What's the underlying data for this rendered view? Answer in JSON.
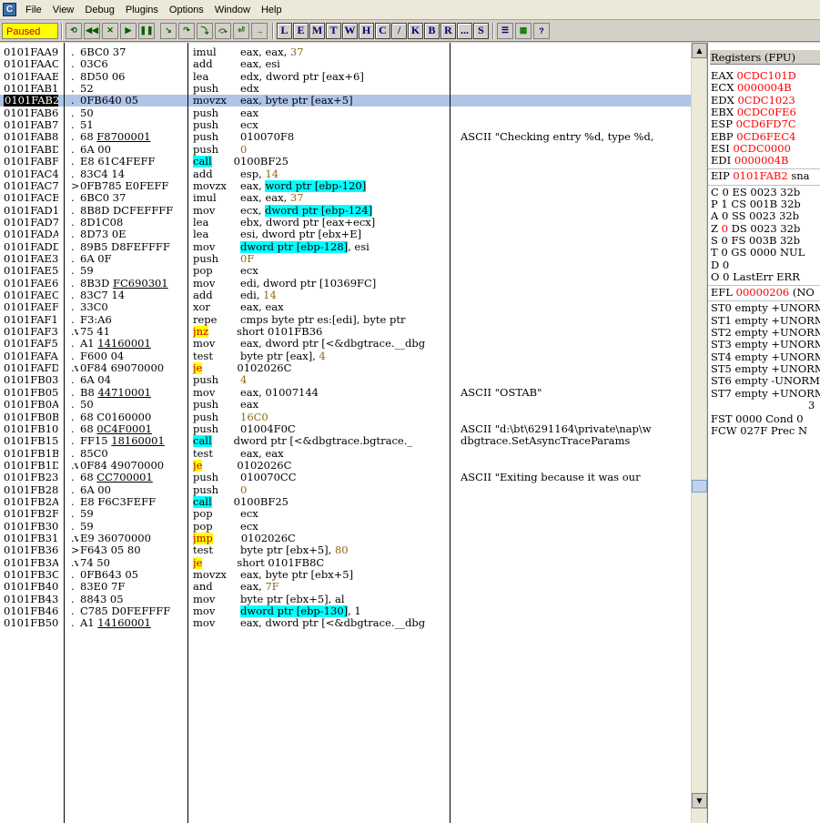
{
  "menu": [
    "File",
    "View",
    "Debug",
    "Plugins",
    "Options",
    "Window",
    "Help"
  ],
  "toolbar": {
    "status": "Paused",
    "buttons": [
      "restart-icon",
      "rewind-icon",
      "close-icon",
      "play-icon",
      "pause-icon",
      "step-into-icon",
      "step-over-icon",
      "trace-into-icon",
      "trace-over-icon",
      "execute-till-return-icon",
      "goto-icon"
    ],
    "letters": [
      "L",
      "E",
      "M",
      "T",
      "W",
      "H",
      "C",
      "/",
      "K",
      "B",
      "R",
      "...",
      "S"
    ]
  },
  "disasm": [
    {
      "addr": "0101FAA9",
      "sym": ".",
      "hex": "6BC0 37",
      "mn": "imul",
      "ops": "eax, eax, 37",
      "cmt": ""
    },
    {
      "addr": "0101FAAC",
      "sym": ".",
      "hex": "03C6",
      "mn": "add",
      "ops": "eax, esi",
      "cmt": ""
    },
    {
      "addr": "0101FAAE",
      "sym": ".",
      "hex": "8D50 06",
      "mn": "lea",
      "ops": "edx, dword ptr [eax+6]",
      "cmt": ""
    },
    {
      "addr": "0101FAB1",
      "sym": ".",
      "hex": "52",
      "mn": "push",
      "ops": "edx",
      "cmt": ""
    },
    {
      "addr": "0101FAB2",
      "sym": ".",
      "hex": "0FB640 05",
      "mn": "movzx",
      "ops": "eax, byte ptr [eax+5]",
      "cmt": "",
      "selected": true
    },
    {
      "addr": "0101FAB6",
      "sym": ".",
      "hex": "50",
      "mn": "push",
      "ops": "eax",
      "cmt": ""
    },
    {
      "addr": "0101FAB7",
      "sym": ".",
      "hex": "51",
      "mn": "push",
      "ops": "ecx",
      "cmt": ""
    },
    {
      "addr": "0101FAB8",
      "sym": ".",
      "hex": "68 F8700001",
      "mn": "push",
      "ops": "010070F8",
      "cmt": "ASCII \"Checking entry %d, type %d,"
    },
    {
      "addr": "0101FABD",
      "sym": ".",
      "hex": "6A 00",
      "mn": "push",
      "ops": "0",
      "cmt": ""
    },
    {
      "addr": "0101FABF",
      "sym": ".",
      "hex": "E8 61C4FEFF",
      "mn": "call",
      "ops": "0100BF25",
      "cmt": "",
      "kind": "call"
    },
    {
      "addr": "0101FAC4",
      "sym": ".",
      "hex": "83C4 14",
      "mn": "add",
      "ops": "esp, 14",
      "cmt": ""
    },
    {
      "addr": "0101FAC7",
      "sym": ">",
      "hex": "0FB785 E0FEFF",
      "mn": "movzx",
      "ops": "eax, word ptr [ebp-120]",
      "cmt": "",
      "mem": "word ptr [ebp-120]"
    },
    {
      "addr": "0101FACE",
      "sym": ".",
      "hex": "6BC0 37",
      "mn": "imul",
      "ops": "eax, eax, 37",
      "cmt": ""
    },
    {
      "addr": "0101FAD1",
      "sym": ".",
      "hex": "8B8D DCFEFFFF",
      "mn": "mov",
      "ops": "ecx, dword ptr [ebp-124]",
      "cmt": "",
      "mem": "dword ptr [ebp-124]"
    },
    {
      "addr": "0101FAD7",
      "sym": ".",
      "hex": "8D1C08",
      "mn": "lea",
      "ops": "ebx, dword ptr [eax+ecx]",
      "cmt": ""
    },
    {
      "addr": "0101FADA",
      "sym": ".",
      "hex": "8D73 0E",
      "mn": "lea",
      "ops": "esi, dword ptr [ebx+E]",
      "cmt": ""
    },
    {
      "addr": "0101FADD",
      "sym": ".",
      "hex": "89B5 D8FEFFFF",
      "mn": "mov",
      "ops": "dword ptr [ebp-128], esi",
      "cmt": "",
      "mem": "dword ptr [ebp-128]"
    },
    {
      "addr": "0101FAE3",
      "sym": ".",
      "hex": "6A 0F",
      "mn": "push",
      "ops": "0F",
      "cmt": ""
    },
    {
      "addr": "0101FAE5",
      "sym": ".",
      "hex": "59",
      "mn": "pop",
      "ops": "ecx",
      "cmt": ""
    },
    {
      "addr": "0101FAE6",
      "sym": ".",
      "hex": "8B3D FC690301",
      "mn": "mov",
      "ops": "edi, dword ptr [10369FC]",
      "cmt": ""
    },
    {
      "addr": "0101FAEC",
      "sym": ".",
      "hex": "83C7 14",
      "mn": "add",
      "ops": "edi, 14",
      "cmt": ""
    },
    {
      "addr": "0101FAEF",
      "sym": ".",
      "hex": "33C0",
      "mn": "xor",
      "ops": "eax, eax",
      "cmt": ""
    },
    {
      "addr": "0101FAF1",
      "sym": ".",
      "hex": "F3:A6",
      "mn": "repe",
      "ops": "cmps byte ptr es:[edi], byte ptr",
      "cmt": ""
    },
    {
      "addr": "0101FAF3",
      "sym": ".v",
      "hex": "75 41",
      "mn": "jnz",
      "ops": "short 0101FB36",
      "cmt": "",
      "kind": "jmp"
    },
    {
      "addr": "0101FAF5",
      "sym": ".",
      "hex": "A1 14160001",
      "mn": "mov",
      "ops": "eax, dword ptr [<&dbgtrace.__dbg",
      "cmt": ""
    },
    {
      "addr": "0101FAFA",
      "sym": ".",
      "hex": "F600 04",
      "mn": "test",
      "ops": "byte ptr [eax], 4",
      "cmt": ""
    },
    {
      "addr": "0101FAFD",
      "sym": ".v",
      "hex": "0F84 69070000",
      "mn": "je",
      "ops": "0102026C",
      "cmt": "",
      "kind": "jmp"
    },
    {
      "addr": "0101FB03",
      "sym": ".",
      "hex": "6A 04",
      "mn": "push",
      "ops": "4",
      "cmt": ""
    },
    {
      "addr": "0101FB05",
      "sym": ".",
      "hex": "B8 44710001",
      "mn": "mov",
      "ops": "eax, 01007144",
      "cmt": "ASCII \"OSTAB\""
    },
    {
      "addr": "0101FB0A",
      "sym": ".",
      "hex": "50",
      "mn": "push",
      "ops": "eax",
      "cmt": ""
    },
    {
      "addr": "0101FB0B",
      "sym": ".",
      "hex": "68 C0160000",
      "mn": "push",
      "ops": "16C0",
      "cmt": ""
    },
    {
      "addr": "0101FB10",
      "sym": ".",
      "hex": "68 0C4F0001",
      "mn": "push",
      "ops": "01004F0C",
      "cmt": "ASCII \"d:\\bt\\6291164\\private\\nap\\w"
    },
    {
      "addr": "0101FB15",
      "sym": ".",
      "hex": "FF15 18160001",
      "mn": "call",
      "ops": "dword ptr [<&dbgtrace.bgtrace._",
      "cmt": "dbgtrace.SetAsyncTraceParams",
      "kind": "call"
    },
    {
      "addr": "0101FB1B",
      "sym": ".",
      "hex": "85C0",
      "mn": "test",
      "ops": "eax, eax",
      "cmt": ""
    },
    {
      "addr": "0101FB1D",
      "sym": ".v",
      "hex": "0F84 49070000",
      "mn": "je",
      "ops": "0102026C",
      "cmt": "",
      "kind": "jmp"
    },
    {
      "addr": "0101FB23",
      "sym": ".",
      "hex": "68 CC700001",
      "mn": "push",
      "ops": "010070CC",
      "cmt": "ASCII \"Exiting because it was our"
    },
    {
      "addr": "0101FB28",
      "sym": ".",
      "hex": "6A 00",
      "mn": "push",
      "ops": "0",
      "cmt": ""
    },
    {
      "addr": "0101FB2A",
      "sym": ".",
      "hex": "E8 F6C3FEFF",
      "mn": "call",
      "ops": "0100BF25",
      "cmt": "",
      "kind": "call"
    },
    {
      "addr": "0101FB2F",
      "sym": ".",
      "hex": "59",
      "mn": "pop",
      "ops": "ecx",
      "cmt": ""
    },
    {
      "addr": "0101FB30",
      "sym": ".",
      "hex": "59",
      "mn": "pop",
      "ops": "ecx",
      "cmt": ""
    },
    {
      "addr": "0101FB31",
      "sym": ".v",
      "hex": "E9 36070000",
      "mn": "jmp",
      "ops": "0102026C",
      "cmt": "",
      "kind": "jmp"
    },
    {
      "addr": "0101FB36",
      "sym": ">",
      "hex": "F643 05 80",
      "mn": "test",
      "ops": "byte ptr [ebx+5], 80",
      "cmt": ""
    },
    {
      "addr": "0101FB3A",
      "sym": ".v",
      "hex": "74 50",
      "mn": "je",
      "ops": "short 0101FB8C",
      "cmt": "",
      "kind": "jmp"
    },
    {
      "addr": "0101FB3C",
      "sym": ".",
      "hex": "0FB643 05",
      "mn": "movzx",
      "ops": "eax, byte ptr [ebx+5]",
      "cmt": ""
    },
    {
      "addr": "0101FB40",
      "sym": ".",
      "hex": "83E0 7F",
      "mn": "and",
      "ops": "eax, 7F",
      "cmt": ""
    },
    {
      "addr": "0101FB43",
      "sym": ".",
      "hex": "8843 05",
      "mn": "mov",
      "ops": "byte ptr [ebx+5], al",
      "cmt": ""
    },
    {
      "addr": "0101FB46",
      "sym": ".",
      "hex": "C785 D0FEFFFF",
      "mn": "mov",
      "ops": "dword ptr [ebp-130], 1",
      "cmt": "",
      "mem": "dword ptr [ebp-130]"
    },
    {
      "addr": "0101FB50",
      "sym": ".",
      "hex": "A1 14160001",
      "mn": "mov",
      "ops": "eax, dword ptr [<&dbgtrace.__dbg",
      "cmt": ""
    }
  ],
  "registers": {
    "title": "Registers (FPU)",
    "gp": [
      {
        "name": "EAX",
        "val": "0CDC101D",
        "changed": true
      },
      {
        "name": "ECX",
        "val": "0000004B",
        "changed": true
      },
      {
        "name": "EDX",
        "val": "0CDC1023",
        "changed": true
      },
      {
        "name": "EBX",
        "val": "0CDC0FE6",
        "changed": true
      },
      {
        "name": "ESP",
        "val": "0CD6FD7C",
        "changed": true
      },
      {
        "name": "EBP",
        "val": "0CD6FEC4",
        "changed": true
      },
      {
        "name": "ESI",
        "val": "0CDC0000",
        "changed": true
      },
      {
        "name": "EDI",
        "val": "0000004B",
        "changed": true
      }
    ],
    "eip": {
      "name": "EIP",
      "val": "0101FAB2",
      "suffix": "sna"
    },
    "flags": [
      {
        "f": "C",
        "v": "0",
        "seg": "ES 0023 32b",
        "changed": false
      },
      {
        "f": "P",
        "v": "1",
        "seg": "CS 001B 32b",
        "changed": false
      },
      {
        "f": "A",
        "v": "0",
        "seg": "SS 0023 32b",
        "changed": false
      },
      {
        "f": "Z",
        "v": "0",
        "seg": "DS 0023 32b",
        "changed": true
      },
      {
        "f": "S",
        "v": "0",
        "seg": "FS 003B 32b",
        "changed": false
      },
      {
        "f": "T",
        "v": "0",
        "seg": "GS 0000 NUL",
        "changed": false
      },
      {
        "f": "D",
        "v": "0",
        "seg": "",
        "changed": false
      },
      {
        "f": "O",
        "v": "0",
        "seg": "LastErr ERR",
        "changed": false
      }
    ],
    "efl": {
      "name": "EFL",
      "val": "00000206",
      "suffix": "(NO"
    },
    "st": [
      "ST0 empty +UNORM",
      "ST1 empty +UNORM",
      "ST2 empty +UNORM",
      "ST3 empty +UNORM",
      "ST4 empty +UNORM",
      "ST5 empty +UNORM",
      "ST6 empty -UNORM",
      "ST7 empty +UNORM"
    ],
    "st_extra": "3",
    "fst": "FST 0000  Cond 0",
    "fcw": "FCW 027F  Prec N"
  }
}
